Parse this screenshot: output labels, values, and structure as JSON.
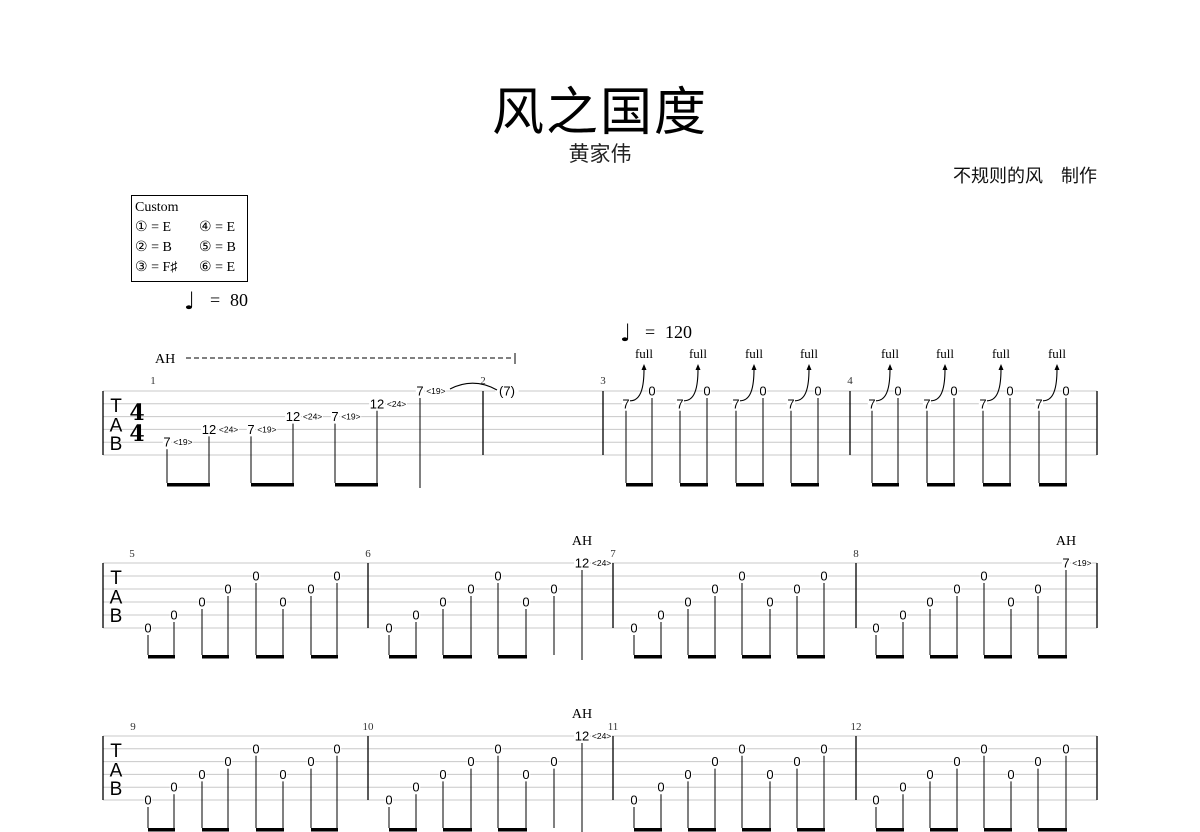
{
  "header": {
    "title": "风之国度",
    "artist": "黄家伟",
    "credit": "不规则的风　制作"
  },
  "tuning": {
    "label": "Custom",
    "strings": [
      {
        "num": "①",
        "note": "E"
      },
      {
        "num": "②",
        "note": "B"
      },
      {
        "num": "③",
        "note": "F♯"
      },
      {
        "num": "④",
        "note": "E"
      },
      {
        "num": "⑤",
        "note": "B"
      },
      {
        "num": "⑥",
        "note": "E"
      }
    ]
  },
  "tempos": [
    {
      "symbol": "♩",
      "equals": "=",
      "value": "80"
    },
    {
      "symbol": "♩",
      "equals": "=",
      "value": "120"
    }
  ],
  "clef": {
    "letters": [
      "T",
      "A",
      "B"
    ]
  },
  "time_signature": {
    "top": "4",
    "bottom": "4"
  },
  "measures": [
    {
      "number": "1",
      "technique_span": "AH",
      "notes": [
        {
          "string": 5,
          "fret": "7",
          "harmonic": "<19>",
          "duration": "eighth"
        },
        {
          "string": 4,
          "fret": "12",
          "harmonic": "<24>",
          "duration": "eighth"
        },
        {
          "string": 4,
          "fret": "7",
          "harmonic": "<19>",
          "duration": "eighth"
        },
        {
          "string": 3,
          "fret": "12",
          "harmonic": "<24>",
          "duration": "eighth"
        },
        {
          "string": 3,
          "fret": "7",
          "harmonic": "<19>",
          "duration": "eighth"
        },
        {
          "string": 2,
          "fret": "12",
          "harmonic": "<24>",
          "duration": "eighth"
        },
        {
          "string": 1,
          "fret": "7",
          "harmonic": "<19>",
          "duration": "half"
        }
      ]
    },
    {
      "number": "2",
      "notes": [
        {
          "string": 1,
          "fret": "(7)",
          "tied": true,
          "duration": "whole"
        }
      ]
    },
    {
      "number": "3",
      "notes": [
        {
          "string": 2,
          "fret": "7",
          "bend": "full",
          "duration": "eighth"
        },
        {
          "string": 1,
          "fret": "0",
          "duration": "eighth"
        },
        {
          "string": 2,
          "fret": "7",
          "bend": "full",
          "duration": "eighth"
        },
        {
          "string": 1,
          "fret": "0",
          "duration": "eighth"
        },
        {
          "string": 2,
          "fret": "7",
          "bend": "full",
          "duration": "eighth"
        },
        {
          "string": 1,
          "fret": "0",
          "duration": "eighth"
        },
        {
          "string": 2,
          "fret": "7",
          "bend": "full",
          "duration": "eighth"
        },
        {
          "string": 1,
          "fret": "0",
          "duration": "eighth"
        }
      ]
    },
    {
      "number": "4",
      "notes": [
        {
          "string": 2,
          "fret": "7",
          "bend": "full",
          "duration": "eighth"
        },
        {
          "string": 1,
          "fret": "0",
          "duration": "eighth"
        },
        {
          "string": 2,
          "fret": "7",
          "bend": "full",
          "duration": "eighth"
        },
        {
          "string": 1,
          "fret": "0",
          "duration": "eighth"
        },
        {
          "string": 2,
          "fret": "7",
          "bend": "full",
          "duration": "eighth"
        },
        {
          "string": 1,
          "fret": "0",
          "duration": "eighth"
        },
        {
          "string": 2,
          "fret": "7",
          "bend": "full",
          "duration": "eighth"
        },
        {
          "string": 1,
          "fret": "0",
          "duration": "eighth"
        }
      ]
    },
    {
      "number": "5",
      "notes": [
        {
          "string": 6,
          "fret": "0",
          "duration": "eighth"
        },
        {
          "string": 5,
          "fret": "0",
          "duration": "eighth"
        },
        {
          "string": 4,
          "fret": "0",
          "duration": "eighth"
        },
        {
          "string": 3,
          "fret": "0",
          "duration": "eighth"
        },
        {
          "string": 2,
          "fret": "0",
          "duration": "eighth"
        },
        {
          "string": 4,
          "fret": "0",
          "duration": "eighth"
        },
        {
          "string": 3,
          "fret": "0",
          "duration": "eighth"
        },
        {
          "string": 2,
          "fret": "0",
          "duration": "eighth"
        }
      ]
    },
    {
      "number": "6",
      "notes": [
        {
          "string": 6,
          "fret": "0",
          "duration": "eighth"
        },
        {
          "string": 5,
          "fret": "0",
          "duration": "eighth"
        },
        {
          "string": 4,
          "fret": "0",
          "duration": "eighth"
        },
        {
          "string": 3,
          "fret": "0",
          "duration": "eighth"
        },
        {
          "string": 2,
          "fret": "0",
          "duration": "eighth"
        },
        {
          "string": 4,
          "fret": "0",
          "duration": "eighth"
        },
        {
          "string": 3,
          "fret": "0",
          "duration": "eighth"
        },
        {
          "string": 1,
          "fret": "12",
          "harmonic": "<24>",
          "technique": "AH",
          "duration": "quarter"
        }
      ]
    },
    {
      "number": "7",
      "notes": [
        {
          "string": 6,
          "fret": "0",
          "duration": "eighth"
        },
        {
          "string": 5,
          "fret": "0",
          "duration": "eighth"
        },
        {
          "string": 4,
          "fret": "0",
          "duration": "eighth"
        },
        {
          "string": 3,
          "fret": "0",
          "duration": "eighth"
        },
        {
          "string": 2,
          "fret": "0",
          "duration": "eighth"
        },
        {
          "string": 4,
          "fret": "0",
          "duration": "eighth"
        },
        {
          "string": 3,
          "fret": "0",
          "duration": "eighth"
        },
        {
          "string": 2,
          "fret": "0",
          "duration": "eighth"
        }
      ]
    },
    {
      "number": "8",
      "notes": [
        {
          "string": 6,
          "fret": "0",
          "duration": "eighth"
        },
        {
          "string": 5,
          "fret": "0",
          "duration": "eighth"
        },
        {
          "string": 4,
          "fret": "0",
          "duration": "eighth"
        },
        {
          "string": 3,
          "fret": "0",
          "duration": "eighth"
        },
        {
          "string": 2,
          "fret": "0",
          "duration": "eighth"
        },
        {
          "string": 4,
          "fret": "0",
          "duration": "eighth"
        },
        {
          "string": 3,
          "fret": "0",
          "duration": "eighth"
        },
        {
          "string": 1,
          "fret": "7",
          "harmonic": "<19>",
          "technique": "AH",
          "duration": "eighth"
        }
      ]
    },
    {
      "number": "9",
      "notes": [
        {
          "string": 6,
          "fret": "0",
          "duration": "eighth"
        },
        {
          "string": 5,
          "fret": "0",
          "duration": "eighth"
        },
        {
          "string": 4,
          "fret": "0",
          "duration": "eighth"
        },
        {
          "string": 3,
          "fret": "0",
          "duration": "eighth"
        },
        {
          "string": 2,
          "fret": "0",
          "duration": "eighth"
        },
        {
          "string": 4,
          "fret": "0",
          "duration": "eighth"
        },
        {
          "string": 3,
          "fret": "0",
          "duration": "eighth"
        },
        {
          "string": 2,
          "fret": "0",
          "duration": "eighth"
        }
      ]
    },
    {
      "number": "10",
      "notes": [
        {
          "string": 6,
          "fret": "0",
          "duration": "eighth"
        },
        {
          "string": 5,
          "fret": "0",
          "duration": "eighth"
        },
        {
          "string": 4,
          "fret": "0",
          "duration": "eighth"
        },
        {
          "string": 3,
          "fret": "0",
          "duration": "eighth"
        },
        {
          "string": 2,
          "fret": "0",
          "duration": "eighth"
        },
        {
          "string": 4,
          "fret": "0",
          "duration": "eighth"
        },
        {
          "string": 3,
          "fret": "0",
          "duration": "eighth"
        },
        {
          "string": 1,
          "fret": "12",
          "harmonic": "<24>",
          "technique": "AH",
          "duration": "quarter"
        }
      ]
    },
    {
      "number": "11",
      "notes": [
        {
          "string": 6,
          "fret": "0",
          "duration": "eighth"
        },
        {
          "string": 5,
          "fret": "0",
          "duration": "eighth"
        },
        {
          "string": 4,
          "fret": "0",
          "duration": "eighth"
        },
        {
          "string": 3,
          "fret": "0",
          "duration": "eighth"
        },
        {
          "string": 2,
          "fret": "0",
          "duration": "eighth"
        },
        {
          "string": 4,
          "fret": "0",
          "duration": "eighth"
        },
        {
          "string": 3,
          "fret": "0",
          "duration": "eighth"
        },
        {
          "string": 2,
          "fret": "0",
          "duration": "eighth"
        }
      ]
    },
    {
      "number": "12",
      "notes": [
        {
          "string": 6,
          "fret": "0",
          "duration": "eighth"
        },
        {
          "string": 5,
          "fret": "0",
          "duration": "eighth"
        },
        {
          "string": 4,
          "fret": "0",
          "duration": "eighth"
        },
        {
          "string": 3,
          "fret": "0",
          "duration": "eighth"
        },
        {
          "string": 2,
          "fret": "0",
          "duration": "eighth"
        },
        {
          "string": 4,
          "fret": "0",
          "duration": "eighth"
        },
        {
          "string": 3,
          "fret": "0",
          "duration": "eighth"
        },
        {
          "string": 2,
          "fret": "0",
          "duration": "eighth"
        }
      ]
    }
  ]
}
